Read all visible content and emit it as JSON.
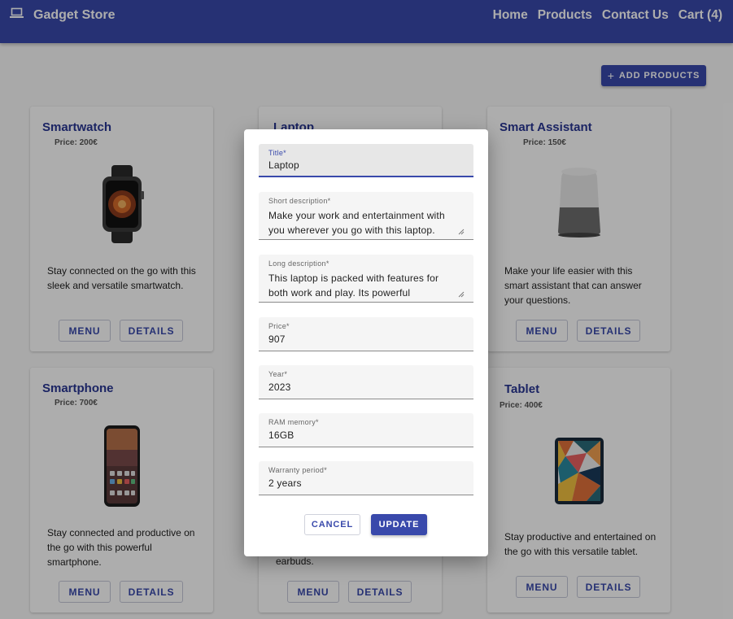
{
  "app": {
    "title": "Gadget Store",
    "icon": "laptop-icon",
    "nav": [
      "Home",
      "Products",
      "Contact Us",
      "Cart (4)"
    ]
  },
  "toolbar": {
    "add_label": "ADD PRODUCTS",
    "add_icon": "plus-icon"
  },
  "products": [
    {
      "title": "Smartwatch",
      "price": "Price: 200€",
      "description": "Stay connected on the go with this sleek and versatile smartwatch.",
      "image": "smartwatch-image"
    },
    {
      "title": "Laptop",
      "price": "",
      "description": "",
      "image": "laptop-image"
    },
    {
      "title": "Smart Assistant",
      "price": "Price: 150€",
      "description": "Make your life easier with this smart assistant that can answer your questions.",
      "image": "smart-speaker-image"
    },
    {
      "title": "Smartphone",
      "price": "Price: 700€",
      "description": "Stay connected and productive on the go with this powerful smartphone.",
      "image": "smartphone-image"
    },
    {
      "title": "",
      "price": "",
      "description": "earbuds.",
      "image": "earbuds-image"
    },
    {
      "title": "Tablet",
      "price": "Price: 400€",
      "description": "Stay productive and entertained on the go with this versatile tablet.",
      "image": "tablet-image"
    }
  ],
  "card_buttons": {
    "menu": "MENU",
    "details": "DETAILS"
  },
  "dialog": {
    "fields": {
      "title": {
        "label": "Title*",
        "value": "Laptop"
      },
      "short": {
        "label": "Short description*",
        "value": " Make your work and entertainment with you wherever you go with this laptop."
      },
      "long": {
        "label": "Long description*",
        "value": "This laptop is packed with features for both work and play. Its powerful"
      },
      "price": {
        "label": "Price*",
        "value": "907"
      },
      "year": {
        "label": "Year*",
        "value": "2023"
      },
      "ram": {
        "label": "RAM memory*",
        "value": "16GB"
      },
      "warranty": {
        "label": "Warranty period*",
        "value": "2 years"
      }
    },
    "cancel_label": "CANCEL",
    "update_label": "UPDATE"
  },
  "colors": {
    "primary": "#3949ab",
    "title": "#283593"
  }
}
